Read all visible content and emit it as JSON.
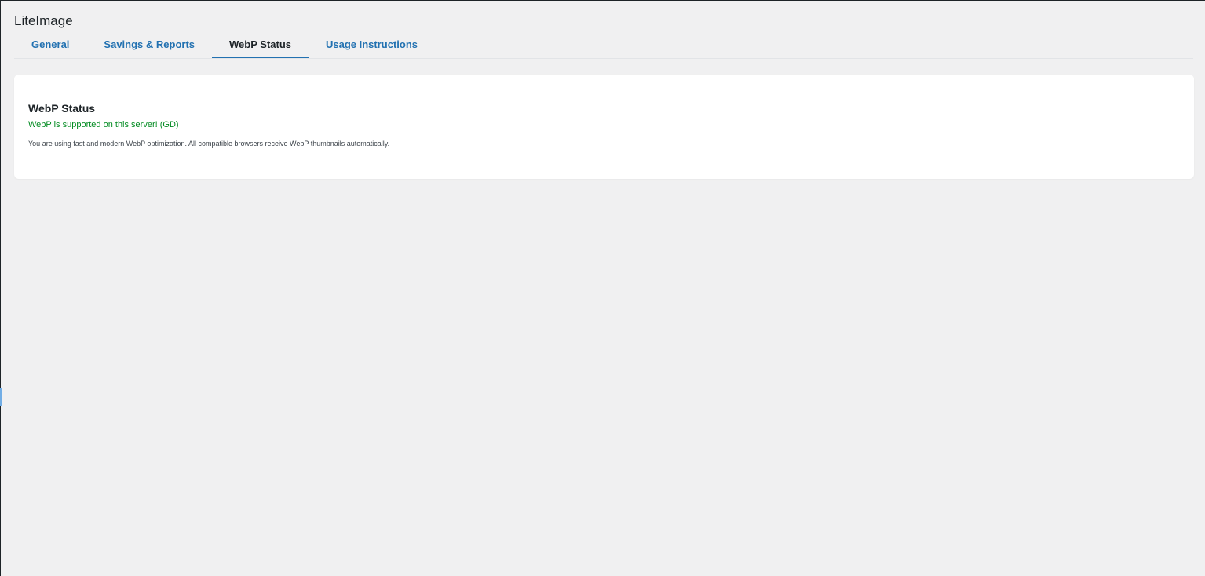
{
  "page": {
    "title": "LiteImage"
  },
  "tabs": [
    {
      "label": "General",
      "active": false
    },
    {
      "label": "Savings & Reports",
      "active": false
    },
    {
      "label": "WebP Status",
      "active": true
    },
    {
      "label": "Usage Instructions",
      "active": false
    }
  ],
  "webp_card": {
    "title": "WebP Status",
    "status": "WebP is supported on this server! (GD)",
    "description": "You are using fast and modern WebP optimization. All compatible browsers receive WebP thumbnails automatically."
  },
  "colors": {
    "link": "#2271b1",
    "success": "#008a20",
    "background": "#f0f0f1",
    "card": "#ffffff"
  }
}
